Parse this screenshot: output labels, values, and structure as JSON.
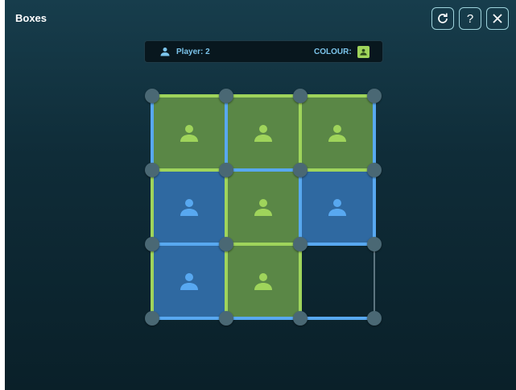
{
  "app": {
    "title": "Boxes",
    "buttons": [
      {
        "name": "restart-button",
        "icon": "refresh-icon"
      },
      {
        "name": "help-button",
        "icon": "help-icon",
        "label": "?"
      },
      {
        "name": "close-button",
        "icon": "close-icon"
      }
    ]
  },
  "status": {
    "player_label": "Player: 2",
    "colour_label": "COLOUR:",
    "colour": "#9fd45b"
  },
  "colors": {
    "player1": "#58a8f0",
    "player2": "#9fd45b",
    "box_player1": "#2f69a1",
    "box_player2": "#5a8746",
    "unclaimed_edge": "#5d7580",
    "dot": "#4a6874"
  },
  "board": {
    "rows": 3,
    "cols": 3,
    "boxes": [
      [
        2,
        2,
        2
      ],
      [
        1,
        2,
        1
      ],
      [
        1,
        2,
        0
      ]
    ],
    "h_edges": [
      [
        2,
        2,
        2
      ],
      [
        2,
        1,
        2
      ],
      [
        1,
        2,
        1
      ],
      [
        1,
        1,
        1
      ]
    ],
    "v_edges": [
      [
        1,
        1,
        2,
        1
      ],
      [
        2,
        2,
        1,
        1
      ],
      [
        2,
        2,
        2,
        0
      ]
    ]
  }
}
